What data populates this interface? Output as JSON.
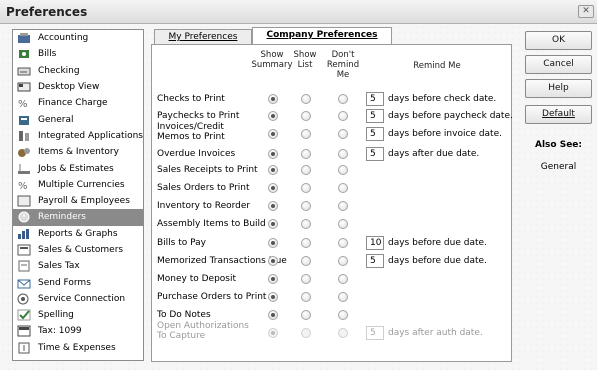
{
  "window": {
    "title": "Preferences",
    "close_glyph": "✕"
  },
  "sidebar": {
    "items": [
      {
        "label": "Accounting",
        "icon": "accounting-icon",
        "color": "#4a6a9a"
      },
      {
        "label": "Bills",
        "icon": "bills-icon",
        "color": "#3b7d3b"
      },
      {
        "label": "Checking",
        "icon": "checking-icon",
        "color": "#555555"
      },
      {
        "label": "Desktop View",
        "icon": "desktop-view-icon",
        "color": "#444444"
      },
      {
        "label": "Finance Charge",
        "icon": "finance-charge-icon",
        "color": "#666666"
      },
      {
        "label": "General",
        "icon": "general-icon",
        "color": "#3a6a8a"
      },
      {
        "label": "Integrated Applications",
        "icon": "integrated-applications-icon",
        "color": "#666666"
      },
      {
        "label": "Items & Inventory",
        "icon": "items-inventory-icon",
        "color": "#8a6a3a"
      },
      {
        "label": "Jobs & Estimates",
        "icon": "jobs-estimates-icon",
        "color": "#777777"
      },
      {
        "label": "Multiple Currencies",
        "icon": "multiple-currencies-icon",
        "color": "#666666"
      },
      {
        "label": "Payroll & Employees",
        "icon": "payroll-employees-icon",
        "color": "#555555"
      },
      {
        "label": "Reminders",
        "icon": "reminders-icon",
        "color": "#555555",
        "selected": true
      },
      {
        "label": "Reports & Graphs",
        "icon": "reports-graphs-icon",
        "color": "#3a5a8a"
      },
      {
        "label": "Sales & Customers",
        "icon": "sales-customers-icon",
        "color": "#555555"
      },
      {
        "label": "Sales Tax",
        "icon": "sales-tax-icon",
        "color": "#666666"
      },
      {
        "label": "Send Forms",
        "icon": "send-forms-icon",
        "color": "#3a6a9a"
      },
      {
        "label": "Service Connection",
        "icon": "service-connection-icon",
        "color": "#555555"
      },
      {
        "label": "Spelling",
        "icon": "spelling-icon",
        "color": "#3b7d3b"
      },
      {
        "label": "Tax: 1099",
        "icon": "tax-1099-icon",
        "color": "#444444"
      },
      {
        "label": "Time & Expenses",
        "icon": "time-expenses-icon",
        "color": "#555555"
      }
    ]
  },
  "tabs": [
    {
      "label": "My Preferences",
      "active": false
    },
    {
      "label": "Company Preferences",
      "active": true
    }
  ],
  "columns": {
    "show_summary": "Show Summary",
    "show_list": "Show List",
    "dont_remind": "Don't Remind Me",
    "remind_me": "Remind Me"
  },
  "rows": [
    {
      "label": "Checks to Print",
      "selected": "summary",
      "days": "5",
      "suffix": "days before check date."
    },
    {
      "label": "Paychecks to Print",
      "selected": "summary",
      "days": "5",
      "suffix": "days before paycheck date."
    },
    {
      "label": "Invoices/Credit Memos to Print",
      "selected": "summary",
      "days": "5",
      "suffix": "days before invoice date."
    },
    {
      "label": "Overdue Invoices",
      "selected": "summary",
      "days": "5",
      "suffix": "days after due date."
    },
    {
      "label": "Sales Receipts to Print",
      "selected": "summary"
    },
    {
      "label": "Sales Orders to Print",
      "selected": "summary"
    },
    {
      "label": "Inventory to Reorder",
      "selected": "summary"
    },
    {
      "label": "Assembly Items to Build",
      "selected": "summary"
    },
    {
      "label": "Bills to Pay",
      "selected": "summary",
      "days": "10",
      "suffix": "days before due date."
    },
    {
      "label": "Memorized Transactions Due",
      "selected": "summary",
      "days": "5",
      "suffix": "days before due date."
    },
    {
      "label": "Money to Deposit",
      "selected": "summary"
    },
    {
      "label": "Purchase Orders to Print",
      "selected": "summary"
    },
    {
      "label": "To Do Notes",
      "selected": "summary"
    },
    {
      "label": "Open Authorizations To Capture",
      "selected": "summary",
      "days": "5",
      "suffix": "days after auth date.",
      "disabled": true
    }
  ],
  "buttons": {
    "ok": "OK",
    "cancel": "Cancel",
    "help": "Help",
    "default": "Default"
  },
  "also_see": {
    "heading": "Also See:",
    "link": "General"
  }
}
